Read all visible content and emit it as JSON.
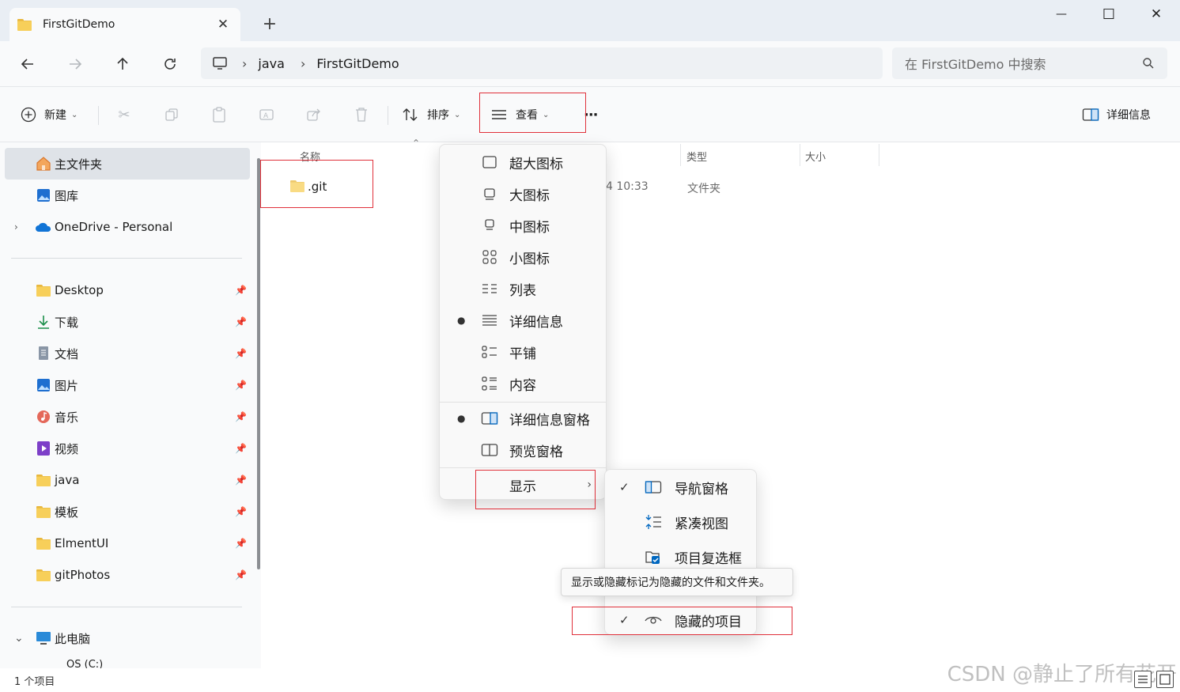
{
  "window": {
    "tab_title": "FirstGitDemo",
    "close_tab_glyph": "✕",
    "new_tab_glyph": "+",
    "minimize_glyph": "—",
    "maximize_glyph": "☐",
    "close_glyph": "✕"
  },
  "address": {
    "breadcrumbs": [
      "java",
      "FirstGitDemo"
    ],
    "search_placeholder": "在 FirstGitDemo 中搜索"
  },
  "toolbar": {
    "new_label": "新建",
    "sort_label": "排序",
    "view_label": "查看",
    "more_label": "···",
    "details_label": "详细信息"
  },
  "sidebar": {
    "top_items": [
      {
        "label": "主文件夹",
        "icon": "home-icon",
        "selected": true
      },
      {
        "label": "图库",
        "icon": "gallery-icon"
      },
      {
        "label": "OneDrive - Personal",
        "icon": "onedrive-icon"
      }
    ],
    "pinned_items": [
      {
        "label": "Desktop",
        "icon": "folder-icon"
      },
      {
        "label": "下载",
        "icon": "download-icon"
      },
      {
        "label": "文档",
        "icon": "document-icon"
      },
      {
        "label": "图片",
        "icon": "pictures-icon"
      },
      {
        "label": "音乐",
        "icon": "music-icon"
      },
      {
        "label": "视频",
        "icon": "video-icon"
      },
      {
        "label": "java",
        "icon": "folder-icon"
      },
      {
        "label": "模板",
        "icon": "folder-icon"
      },
      {
        "label": "ElmentUI",
        "icon": "folder-icon"
      },
      {
        "label": "gitPhotos",
        "icon": "folder-icon"
      }
    ],
    "this_pc_label": "此电脑",
    "drive_label": "OS (C:)"
  },
  "file_list": {
    "columns": [
      "名称",
      "类型",
      "大小"
    ],
    "rows": [
      {
        "name": ".git",
        "modified": "4 10:33",
        "type": "文件夹",
        "size": ""
      }
    ]
  },
  "view_menu": {
    "items": [
      {
        "label": "超大图标",
        "icon": "extra-large-icons-icon",
        "bullet": ""
      },
      {
        "label": "大图标",
        "icon": "large-icons-icon",
        "bullet": ""
      },
      {
        "label": "中图标",
        "icon": "medium-icons-icon",
        "bullet": ""
      },
      {
        "label": "小图标",
        "icon": "small-icons-icon",
        "bullet": ""
      },
      {
        "label": "列表",
        "icon": "list-icon",
        "bullet": ""
      },
      {
        "label": "详细信息",
        "icon": "details-icon",
        "bullet": "●"
      },
      {
        "label": "平铺",
        "icon": "tiles-icon",
        "bullet": ""
      },
      {
        "label": "内容",
        "icon": "content-icon",
        "bullet": ""
      }
    ],
    "pane_items": [
      {
        "label": "详细信息窗格",
        "icon": "details-pane-icon",
        "bullet": "●"
      },
      {
        "label": "预览窗格",
        "icon": "preview-pane-icon",
        "bullet": ""
      }
    ],
    "show_label": "显示",
    "show_arrow": "›"
  },
  "show_submenu": {
    "items": [
      {
        "label": "导航窗格",
        "icon": "navigation-pane-icon",
        "check": "✓"
      },
      {
        "label": "紧凑视图",
        "icon": "compact-view-icon",
        "check": ""
      },
      {
        "label": "项目复选框",
        "icon": "item-checkbox-icon",
        "check": ""
      },
      {
        "label": "隐藏的项目",
        "icon": "eye-icon",
        "check": "✓"
      }
    ]
  },
  "tooltip": {
    "text": "显示或隐藏标记为隐藏的文件和文件夹。"
  },
  "status": {
    "item_count": "1 个项目"
  },
  "watermark": "CSDN @静止了所有花开",
  "colors": {
    "highlight_red": "#e0303a",
    "folder_yellow": "#f7cf5a",
    "accent_blue": "#0067c0"
  }
}
